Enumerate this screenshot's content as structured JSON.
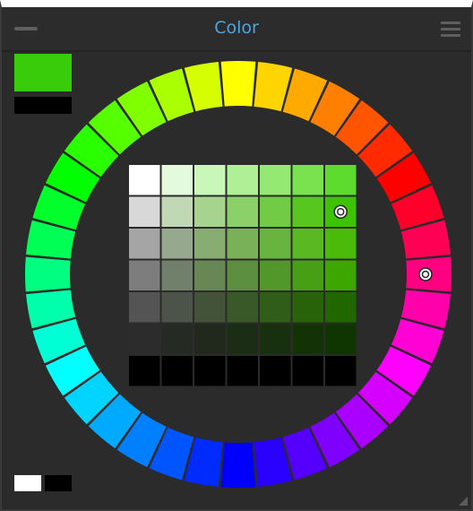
{
  "panel": {
    "title": "Color",
    "collapse_icon": "minus-icon",
    "menu_icon": "hamburger-menu-icon",
    "resize_icon": "resize-grip-icon"
  },
  "colors": {
    "primary": "#39cc0b",
    "secondary": "#000000",
    "reset_light": "#ffffff",
    "reset_dark": "#000000",
    "title_accent": "#4aa7e6",
    "panel_bg": "#2b2b2b"
  },
  "wheel": {
    "segment_count": 36,
    "selected_hue_index": 9
  },
  "grid": {
    "columns": 7,
    "rows": 7,
    "selected_row": 1,
    "selected_col": 6,
    "cells": [
      [
        "#ffffff",
        "#e4fadc",
        "#c9f6b9",
        "#afef95",
        "#93e972",
        "#79e24f",
        "#5edc2d"
      ],
      [
        "#d8d8d8",
        "#c0d8b3",
        "#a6d48f",
        "#8cd06a",
        "#71cb45",
        "#57c71f",
        "#3dc301"
      ],
      [
        "#a5a5a5",
        "#96a88d",
        "#87ad72",
        "#78b158",
        "#69b43e",
        "#5ab823",
        "#4bbb09"
      ],
      [
        "#7d7d7d",
        "#71806b",
        "#678755",
        "#5c8f40",
        "#52972a",
        "#479f15",
        "#3da700"
      ],
      [
        "#545454",
        "#4c5449",
        "#425338",
        "#395a28",
        "#305e19",
        "#286309",
        "#216700"
      ],
      [
        "#2c2c2c",
        "#252a23",
        "#20291c",
        "#1b2d15",
        "#17300d",
        "#133306",
        "#103600"
      ],
      [
        "#000000",
        "#000000",
        "#000000",
        "#000000",
        "#000000",
        "#000000",
        "#000000"
      ]
    ]
  }
}
